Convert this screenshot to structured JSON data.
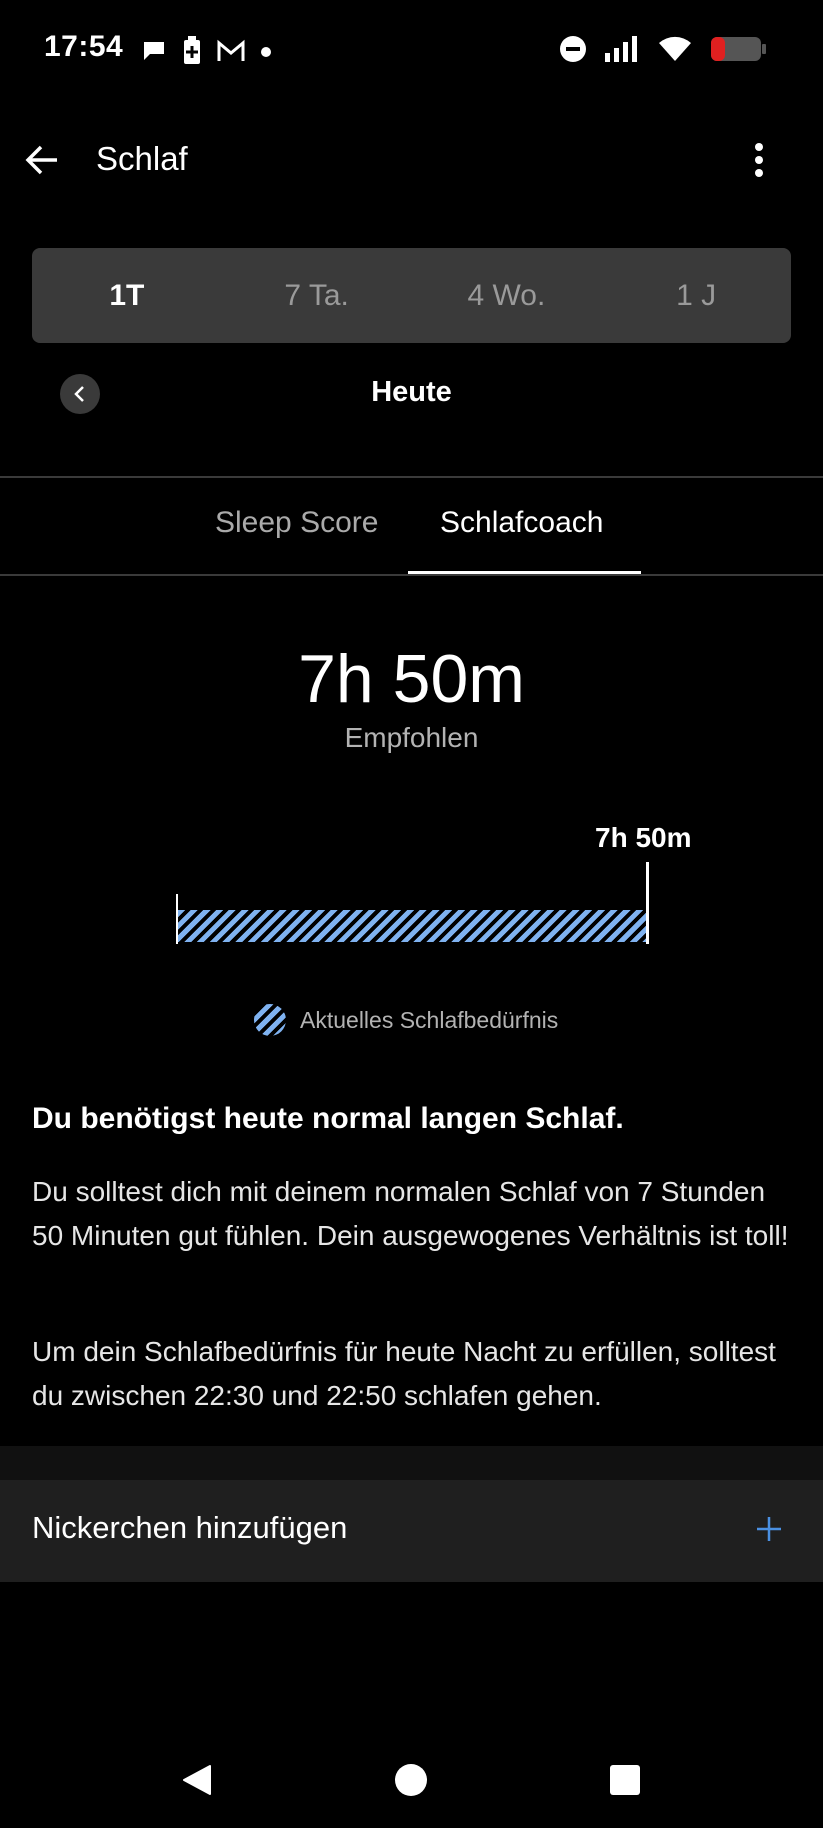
{
  "status_bar": {
    "time": "17:54",
    "left_icons": [
      "chat-icon",
      "battery-saver-icon",
      "gmail-icon",
      "dot-icon"
    ],
    "right_icons": [
      "dnd-icon",
      "signal-icon",
      "wifi-icon",
      "battery-low-icon"
    ]
  },
  "app_bar": {
    "title": "Schlaf"
  },
  "period_selector": {
    "tabs": [
      "1T",
      "7 Ta.",
      "4 Wo.",
      "1 J"
    ],
    "selected": "1T"
  },
  "date_nav": {
    "label": "Heute"
  },
  "tabs": {
    "sleep_score": "Sleep Score",
    "coach": "Schlafcoach",
    "selected": "Schlafcoach"
  },
  "summary": {
    "value": "7h 50m",
    "caption": "Empfohlen"
  },
  "chart_data": {
    "type": "bar",
    "categories": [
      "Aktuelles Schlafbedürfnis"
    ],
    "values": [
      470
    ],
    "marker_label": "7h 50m",
    "legend": [
      "Aktuelles Schlafbedürfnis"
    ]
  },
  "content": {
    "headline": "Du benötigst heute normal langen Schlaf.",
    "paragraph1": "Du solltest dich mit deinem normalen Schlaf von 7 Stunden 50 Minuten gut fühlen. Dein ausgewogenes Verhältnis ist toll!",
    "paragraph2": "Um dein Schlafbedürfnis für heute Nacht zu erfüllen, solltest du zwischen 22:30 und 22:50 schlafen gehen."
  },
  "nap": {
    "label": "Nickerchen hinzufügen"
  },
  "colors": {
    "background": "#000000",
    "accent": "#7fb2f0",
    "plus": "#4a90e2"
  }
}
